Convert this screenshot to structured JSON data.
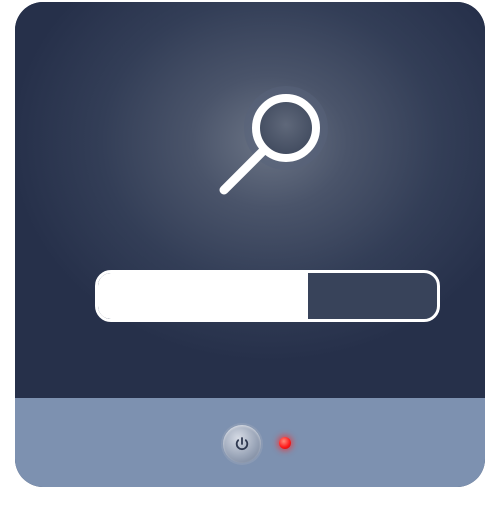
{
  "screen": {
    "icon": "magnifying-glass-icon",
    "progress": {
      "fraction": 0.62
    }
  },
  "base": {
    "power_button": {
      "icon": "power-icon"
    },
    "status_led": {
      "state": "on",
      "color": "#ff1e1e"
    }
  },
  "colors": {
    "screen": "#333e57",
    "base": "#7d91b0",
    "accent": "#ffffff"
  }
}
